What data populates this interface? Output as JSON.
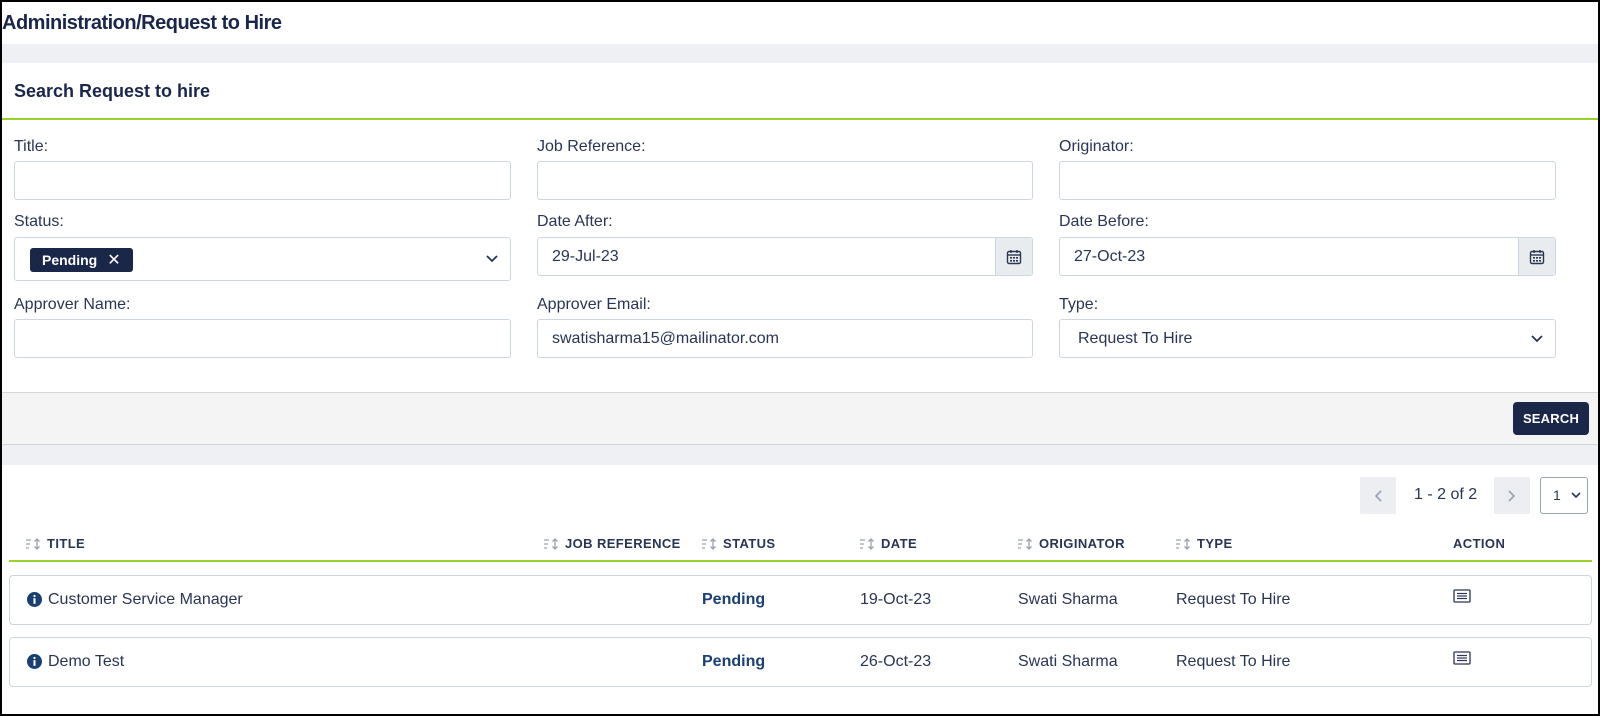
{
  "page": {
    "title": "Administration/Request to Hire"
  },
  "search_panel": {
    "heading": "Search Request to hire",
    "fields": {
      "title": {
        "label": "Title:",
        "value": ""
      },
      "job_reference": {
        "label": "Job Reference:",
        "value": ""
      },
      "originator": {
        "label": "Originator:",
        "value": ""
      },
      "status": {
        "label": "Status:",
        "chip": "Pending",
        "chip_remove": "✕"
      },
      "date_after": {
        "label": "Date After:",
        "value": "29-Jul-23"
      },
      "date_before": {
        "label": "Date Before:",
        "value": "27-Oct-23"
      },
      "approver_name": {
        "label": "Approver Name:",
        "value": ""
      },
      "approver_email": {
        "label": "Approver Email:",
        "value": "swatisharma15@mailinator.com"
      },
      "type": {
        "label": "Type:",
        "value": "Request To Hire"
      }
    },
    "search_button": "SEARCH"
  },
  "pagination": {
    "range_text": "1 - 2 of 2",
    "page": "1"
  },
  "table": {
    "headers": [
      "TITLE",
      "JOB REFERENCE",
      "STATUS",
      "DATE",
      "ORIGINATOR",
      "TYPE",
      "ACTION"
    ],
    "rows": [
      {
        "title": "Customer Service Manager",
        "job_reference": "",
        "status": "Pending",
        "date": "19-Oct-23",
        "originator": "Swati Sharma",
        "type": "Request To Hire"
      },
      {
        "title": "Demo Test",
        "job_reference": "",
        "status": "Pending",
        "date": "26-Oct-23",
        "originator": "Swati Sharma",
        "type": "Request To Hire"
      }
    ]
  },
  "colors": {
    "navy": "#1b2748",
    "accent_green": "#9ad12b",
    "status_text": "#1b3f6e"
  },
  "icons": [
    "calendar-icon",
    "chevron-down-icon",
    "sort-icon",
    "info-icon",
    "details-icon",
    "chevron-left-icon",
    "chevron-right-icon",
    "remove-icon"
  ]
}
